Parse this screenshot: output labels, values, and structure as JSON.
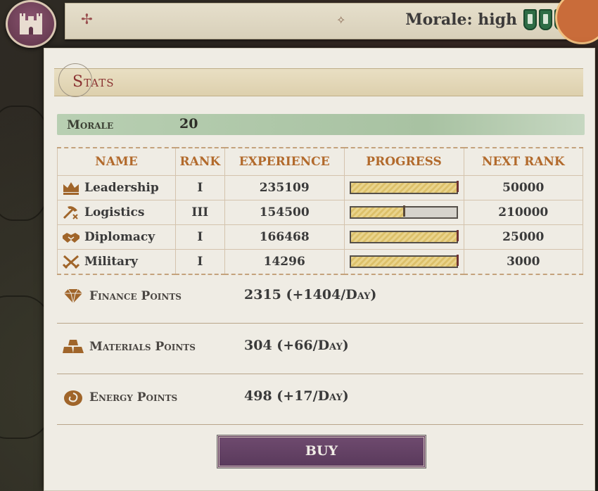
{
  "header": {
    "morale_text": "Morale: high",
    "shields": [
      "shield-icon",
      "shield-icon",
      "shield-icon"
    ],
    "shield_color": "#2f6d46"
  },
  "panel": {
    "title": "Stats",
    "morale": {
      "label": "Morale",
      "value": "20"
    }
  },
  "table": {
    "headers": [
      "NAME",
      "RANK",
      "EXPERIENCE",
      "PROGRESS",
      "NEXT RANK"
    ],
    "rows": [
      {
        "icon": "crown-icon",
        "name": "Leadership",
        "rank": "I",
        "experience": "235109",
        "progress": 1.0,
        "next_rank": "50000"
      },
      {
        "icon": "pickaxe-icon",
        "name": "Logistics",
        "rank": "III",
        "experience": "154500",
        "progress": 0.49,
        "next_rank": "210000"
      },
      {
        "icon": "handshake-icon",
        "name": "Diplomacy",
        "rank": "I",
        "experience": "166468",
        "progress": 1.0,
        "next_rank": "25000"
      },
      {
        "icon": "crossed-swords-icon",
        "name": "Military",
        "rank": "I",
        "experience": "14296",
        "progress": 1.0,
        "next_rank": "3000"
      }
    ]
  },
  "points": [
    {
      "icon": "diamond-icon",
      "label": "Finance Points",
      "value": "2315 (+1404/Day)"
    },
    {
      "icon": "gold-bars-icon",
      "label": "Materials Points",
      "value": "304 (+66/Day)"
    },
    {
      "icon": "energy-swirl-icon",
      "label": "Energy Points",
      "value": "498 (+17/Day)"
    }
  ],
  "buy_label": "BUY",
  "colors": {
    "accent": "#b26a2c",
    "title": "#8a3232",
    "buy": "#5e3d60"
  }
}
